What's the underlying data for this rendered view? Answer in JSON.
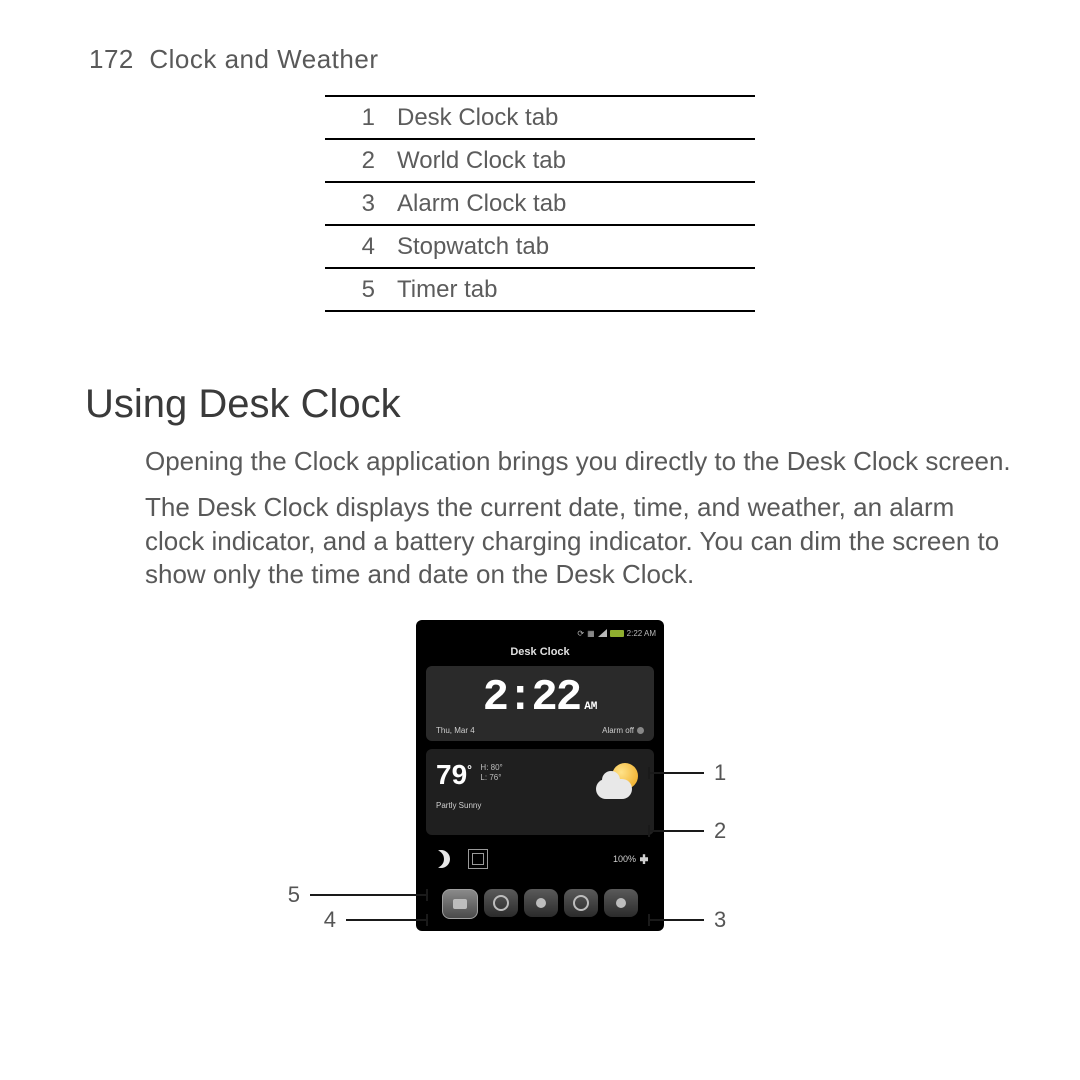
{
  "header": {
    "page_number": "172",
    "chapter": "Clock and Weather"
  },
  "tab_table": [
    {
      "num": "1",
      "label": "Desk Clock tab"
    },
    {
      "num": "2",
      "label": "World Clock tab"
    },
    {
      "num": "3",
      "label": "Alarm Clock tab"
    },
    {
      "num": "4",
      "label": "Stopwatch tab"
    },
    {
      "num": "5",
      "label": "Timer tab"
    }
  ],
  "section_title": "Using Desk Clock",
  "paragraphs": [
    "Opening the Clock application brings you directly to the Desk Clock screen.",
    "The Desk Clock displays the current date, time, and weather, an alarm clock indicator, and a battery charging indicator. You can dim the screen to show only the time and date on the Desk Clock."
  ],
  "phone": {
    "status_time": "2:22 AM",
    "title": "Desk Clock",
    "time": "2:22",
    "ampm": "AM",
    "date": "Thu, Mar 4",
    "alarm_label": "Alarm off",
    "temperature": "79",
    "high": "H: 80°",
    "low": "L: 76°",
    "condition": "Partly Sunny",
    "battery_pct": "100%"
  },
  "callouts": {
    "r1": "1",
    "r2": "2",
    "r3": "3",
    "l4": "4",
    "l5": "5"
  }
}
